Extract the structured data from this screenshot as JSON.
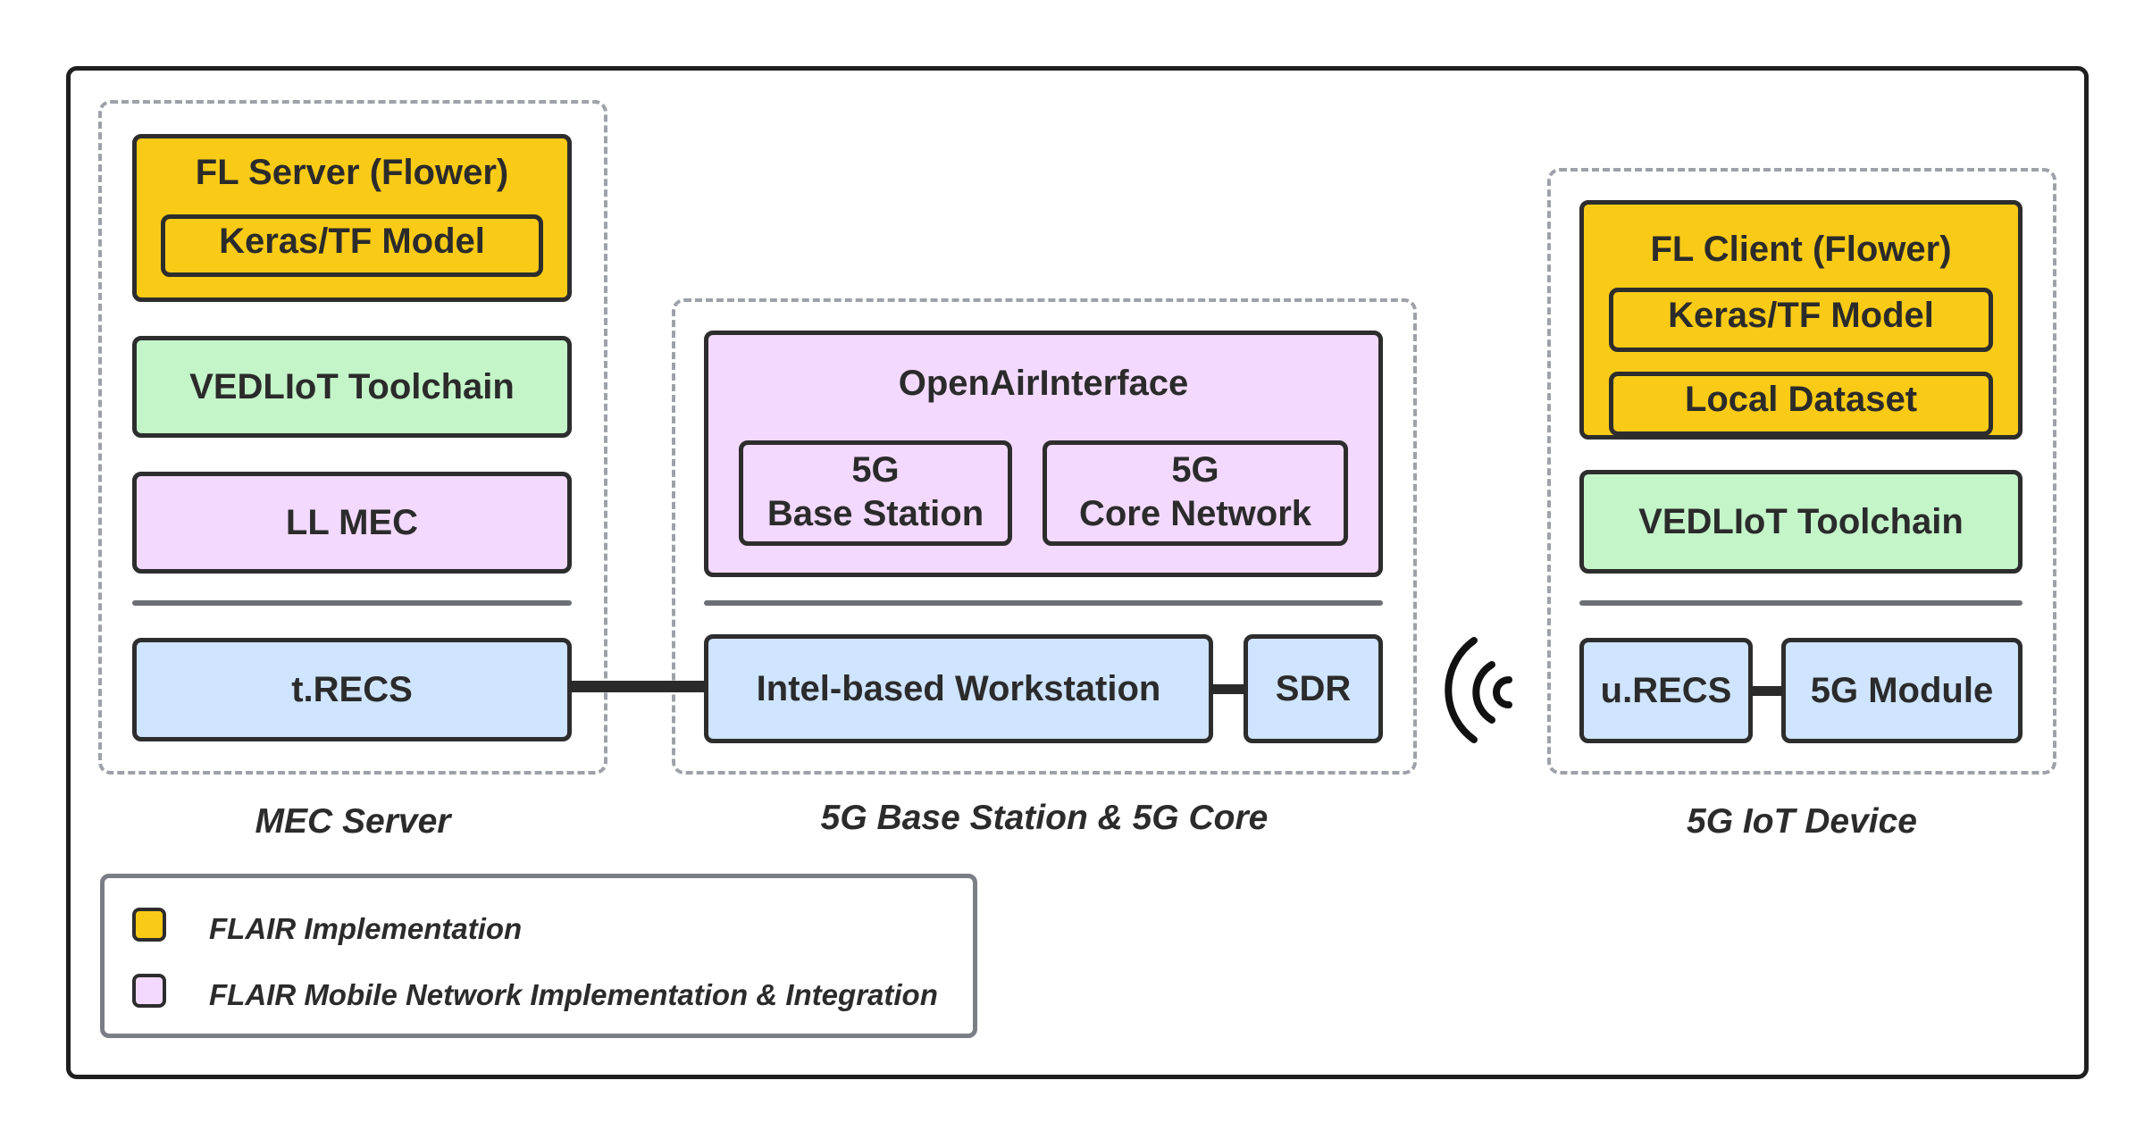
{
  "mec": {
    "fl_server": "FL Server (Flower)",
    "model": "Keras/TF Model",
    "toolchain": "VEDLIoT Toolchain",
    "ll_mec": "LL MEC",
    "trecs": "t.RECS",
    "caption": "MEC Server"
  },
  "bs": {
    "oai": "OpenAirInterface",
    "bs_line1": "5G",
    "bs_line2": "Base Station",
    "cn_line1": "5G",
    "cn_line2": "Core Network",
    "workstation": "Intel-based Workstation",
    "sdr": "SDR",
    "caption": "5G Base Station & 5G Core"
  },
  "iot": {
    "fl_client": "FL Client (Flower)",
    "model": "Keras/TF Model",
    "dataset": "Local Dataset",
    "toolchain": "VEDLIoT Toolchain",
    "urecs": "u.RECS",
    "module": "5G Module",
    "caption": "5G IoT Device"
  },
  "legend": {
    "items": [
      {
        "label": "FLAIR Implementation",
        "color": "#f9cb16"
      },
      {
        "label": "FLAIR Mobile Network Implementation & Integration",
        "color": "#f2d9fd"
      }
    ]
  },
  "colors": {
    "fl_yellow": "#f9cb16",
    "toolchain_green": "#c4f5c9",
    "flair_purple": "#f2d9fd",
    "hardware_blue": "#cfe4ff"
  },
  "icons": {
    "wireless": "wireless-signal-icon"
  }
}
